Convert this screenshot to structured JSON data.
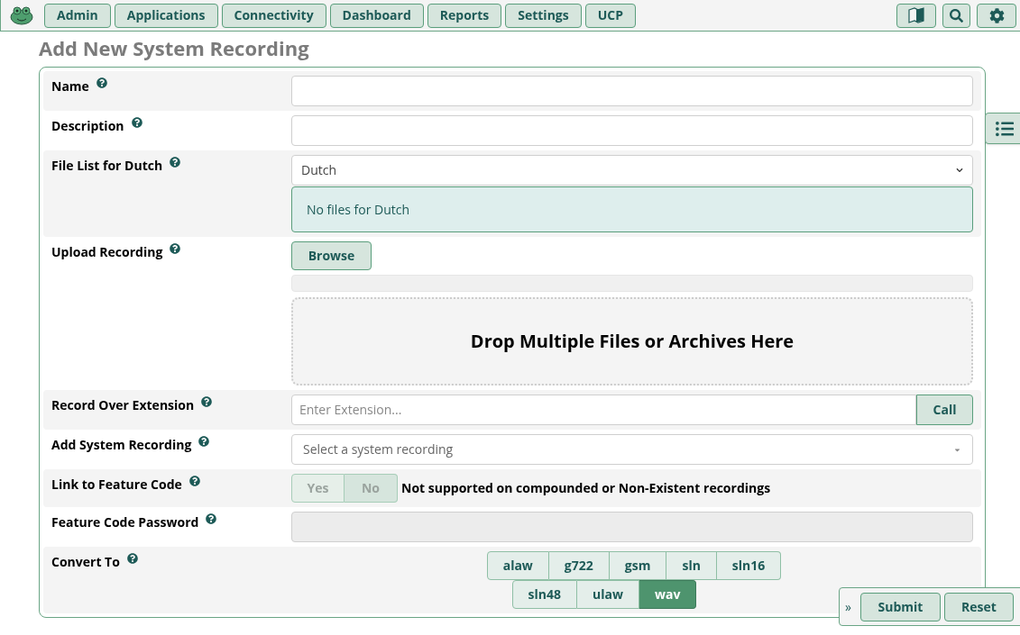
{
  "nav": {
    "items": [
      {
        "label": "Admin"
      },
      {
        "label": "Applications"
      },
      {
        "label": "Connectivity"
      },
      {
        "label": "Dashboard"
      },
      {
        "label": "Reports"
      },
      {
        "label": "Settings"
      },
      {
        "label": "UCP"
      }
    ]
  },
  "page_title": "Add New System Recording",
  "form": {
    "rows": [
      {
        "kind": "text",
        "label": "Name",
        "value": ""
      },
      {
        "kind": "text",
        "label": "Description",
        "value": ""
      },
      {
        "kind": "filelist",
        "label": "File List for Dutch",
        "select_value": "Dutch",
        "message": "No files for Dutch"
      },
      {
        "kind": "upload",
        "label": "Upload Recording",
        "button": "Browse",
        "dropzone": "Drop Multiple Files or Archives Here"
      },
      {
        "kind": "extension",
        "label": "Record Over Extension",
        "placeholder": "Enter Extension...",
        "button": "Call"
      },
      {
        "kind": "combo",
        "label": "Add System Recording",
        "placeholder": "Select a system recording"
      },
      {
        "kind": "toggle",
        "label": "Link to Feature Code",
        "disabled": true,
        "options": [
          {
            "label": "Yes",
            "selected": false
          },
          {
            "label": "No",
            "selected": true
          }
        ],
        "note": "Not supported on compounded or Non-Existent recordings"
      },
      {
        "kind": "disabled_text",
        "label": "Feature Code Password",
        "value": ""
      },
      {
        "kind": "formats",
        "label": "Convert To",
        "rows": [
          [
            {
              "label": "alaw",
              "selected": false
            },
            {
              "label": "g722",
              "selected": false
            },
            {
              "label": "gsm",
              "selected": false
            },
            {
              "label": "sln",
              "selected": false
            },
            {
              "label": "sln16",
              "selected": false
            }
          ],
          [
            {
              "label": "sln48",
              "selected": false
            },
            {
              "label": "ulaw",
              "selected": false
            },
            {
              "label": "wav",
              "selected": true
            }
          ]
        ]
      }
    ]
  },
  "actions": {
    "toggle": "»",
    "buttons": [
      {
        "label": "Submit"
      },
      {
        "label": "Reset"
      }
    ]
  }
}
